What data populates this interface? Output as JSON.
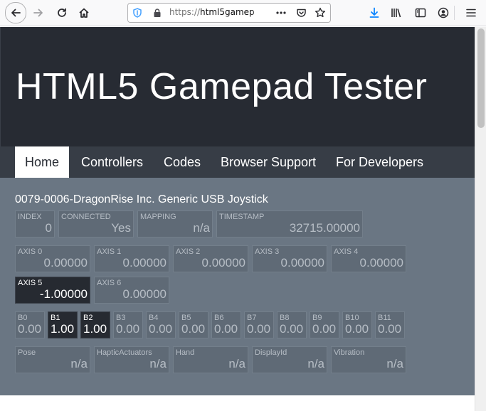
{
  "browser": {
    "url_scheme": "https://",
    "url_host": "html5gamep"
  },
  "page": {
    "title": "HTML5 Gamepad Tester",
    "nav": [
      "Home",
      "Controllers",
      "Codes",
      "Browser Support",
      "For Developers"
    ],
    "device_name": "0079-0006-DragonRise Inc. Generic USB Joystick",
    "info": [
      {
        "label": "INDEX",
        "value": "0"
      },
      {
        "label": "CONNECTED",
        "value": "Yes"
      },
      {
        "label": "MAPPING",
        "value": "n/a"
      },
      {
        "label": "TIMESTAMP",
        "value": "32715.00000"
      }
    ],
    "axes": [
      {
        "label": "AXIS 0",
        "value": "0.00000",
        "active": false
      },
      {
        "label": "AXIS 1",
        "value": "0.00000",
        "active": false
      },
      {
        "label": "AXIS 2",
        "value": "0.00000",
        "active": false
      },
      {
        "label": "AXIS 3",
        "value": "0.00000",
        "active": false
      },
      {
        "label": "AXIS 4",
        "value": "0.00000",
        "active": false
      },
      {
        "label": "AXIS 5",
        "value": "-1.00000",
        "active": true
      },
      {
        "label": "AXIS 6",
        "value": "0.00000",
        "active": false
      }
    ],
    "buttons": [
      {
        "label": "B0",
        "value": "0.00",
        "pressed": false
      },
      {
        "label": "B1",
        "value": "1.00",
        "pressed": true
      },
      {
        "label": "B2",
        "value": "1.00",
        "pressed": true
      },
      {
        "label": "B3",
        "value": "0.00",
        "pressed": false
      },
      {
        "label": "B4",
        "value": "0.00",
        "pressed": false
      },
      {
        "label": "B5",
        "value": "0.00",
        "pressed": false
      },
      {
        "label": "B6",
        "value": "0.00",
        "pressed": false
      },
      {
        "label": "B7",
        "value": "0.00",
        "pressed": false
      },
      {
        "label": "B8",
        "value": "0.00",
        "pressed": false
      },
      {
        "label": "B9",
        "value": "0.00",
        "pressed": false
      },
      {
        "label": "B10",
        "value": "0.00",
        "pressed": false
      },
      {
        "label": "B11",
        "value": "0.00",
        "pressed": false
      }
    ],
    "extras": [
      {
        "label": "Pose",
        "value": "n/a"
      },
      {
        "label": "HapticActuators",
        "value": "n/a"
      },
      {
        "label": "Hand",
        "value": "n/a"
      },
      {
        "label": "DisplayId",
        "value": "n/a"
      },
      {
        "label": "Vibration",
        "value": "n/a"
      }
    ]
  },
  "colors": {
    "hero_bg": "#272b33",
    "nav_bg": "#373d46",
    "content_bg": "#6a7683",
    "active_cell_bg": "#262a31"
  },
  "icons": [
    "back-arrow-icon",
    "forward-arrow-icon",
    "reload-icon",
    "home-icon",
    "shield-icon",
    "lock-icon",
    "more-dots-icon",
    "pocket-icon",
    "bookmark-star-icon",
    "download-icon",
    "library-icon",
    "sidebar-icon",
    "account-icon",
    "hamburger-menu-icon"
  ]
}
